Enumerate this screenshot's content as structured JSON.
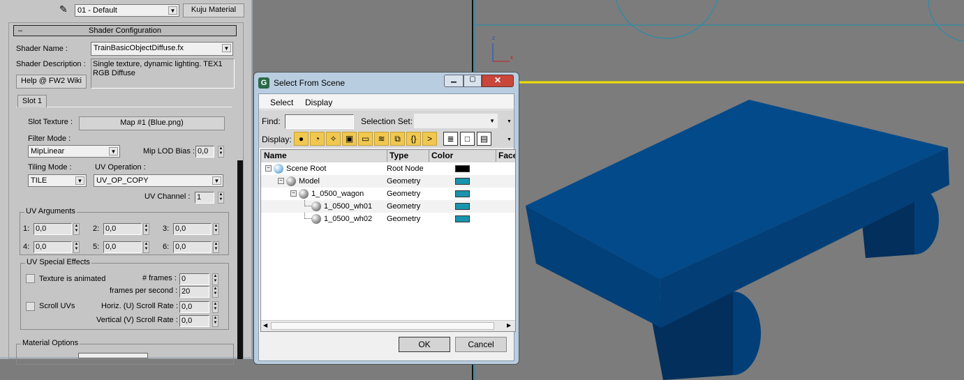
{
  "material": {
    "selector": "01 - Default",
    "type_button": "Kuju Material"
  },
  "shader": {
    "title": "Shader Configuration",
    "collapse": "–",
    "name_label": "Shader Name :",
    "name_value": "TrainBasicObjectDiffuse.fx",
    "desc_label": "Shader Description :",
    "desc_value": "Single texture, dynamic lighting. TEX1 RGB Diffuse",
    "help_button": "Help @ FW2 Wiki"
  },
  "slot": {
    "tab": "Slot 1",
    "texture_label": "Slot Texture :",
    "texture_button": "Map #1 (Blue.png)",
    "filter_label": "Filter Mode :",
    "filter_value": "MipLinear",
    "mip_label": "Mip LOD Bias :",
    "mip_value": "0,0",
    "tiling_label": "Tiling Mode :",
    "tiling_value": "TILE",
    "uvop_label": "UV Operation :",
    "uvop_value": "UV_OP_COPY",
    "uvch_label": "UV Channel :",
    "uvch_value": "1"
  },
  "uv_args": {
    "title": "UV Arguments",
    "items": [
      {
        "label": "1:",
        "value": "0,0"
      },
      {
        "label": "2:",
        "value": "0,0"
      },
      {
        "label": "3:",
        "value": "0,0"
      },
      {
        "label": "4:",
        "value": "0,0"
      },
      {
        "label": "5:",
        "value": "0,0"
      },
      {
        "label": "6:",
        "value": "0,0"
      }
    ]
  },
  "uv_fx": {
    "title": "UV Special Effects",
    "animated_label": "Texture is animated",
    "frames_label": "# frames :",
    "frames_value": "0",
    "fps_label": "frames per second :",
    "fps_value": "20",
    "scroll_label": "Scroll UVs",
    "hrate_label": "Horiz. (U) Scroll Rate :",
    "hrate_value": "0,0",
    "vrate_label": "Vertical (V) Scroll Rate :",
    "vrate_value": "0,0"
  },
  "mat_opts": {
    "title": "Material Options"
  },
  "dialog": {
    "title": "Select From Scene",
    "menu": [
      "Select",
      "Display"
    ],
    "find_label": "Find:",
    "find_value": "",
    "selset_label": "Selection Set:",
    "display_label": "Display:",
    "columns": [
      "Name",
      "Type",
      "Color",
      "Faces"
    ],
    "rows": [
      {
        "name": "Scene Root",
        "type": "Root Node",
        "color": "#000000",
        "depth": 0
      },
      {
        "name": "Model",
        "type": "Geometry",
        "color": "#1a93ad",
        "depth": 1
      },
      {
        "name": "1_0500_wagon",
        "type": "Geometry",
        "color": "#1a93ad",
        "depth": 2
      },
      {
        "name": "1_0500_wh01",
        "type": "Geometry",
        "color": "#1a93ad",
        "depth": 3
      },
      {
        "name": "1_0500_wh02",
        "type": "Geometry",
        "color": "#1a93ad",
        "depth": 3
      }
    ],
    "ok": "OK",
    "cancel": "Cancel"
  },
  "viewport": {
    "axis_z": "z",
    "axis_x": "x",
    "object_color": "#034a8a"
  }
}
